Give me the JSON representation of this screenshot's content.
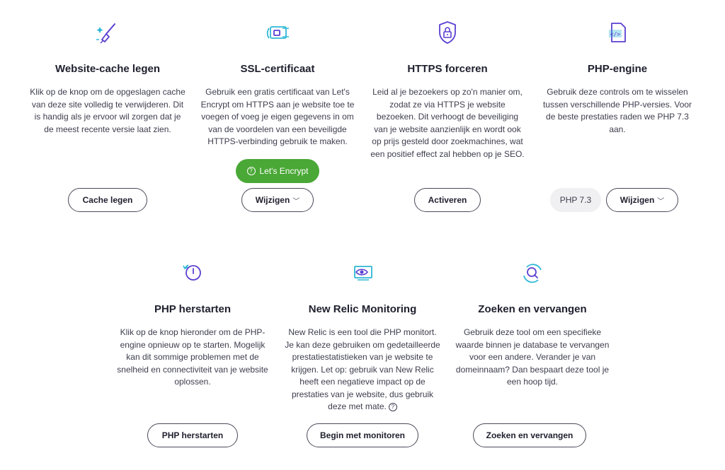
{
  "colors": {
    "accent_purple": "#5b3fd1",
    "accent_cyan": "#2fb8d6",
    "green": "#4aa836"
  },
  "cards": [
    {
      "icon": "broom-icon",
      "title": "Website-cache legen",
      "description": "Klik op de knop om de opgeslagen cache van deze site volledig te verwijderen. Dit is handig als je ervoor wil zorgen dat je de meest recente versie laat zien.",
      "button_label": "Cache legen"
    },
    {
      "icon": "ssl-certificate-icon",
      "title": "SSL-certificaat",
      "description": "Gebruik een gratis certificaat van Let's Encrypt om HTTPS aan je website toe te voegen of voeg je eigen gegevens in om van de voordelen van een beveiligde HTTPS-verbinding gebruik te maken.",
      "badge_label": "Let's Encrypt",
      "button_label": "Wijzigen"
    },
    {
      "icon": "shield-lock-icon",
      "title": "HTTPS forceren",
      "description": "Leid al je bezoekers op zo'n manier om, zodat ze via HTTPS je website bezoeken. Dit verhoogt de beveiliging van je website aanzienlijk en wordt ook op prijs gesteld door zoekmachines, wat een positief effect zal hebben op je SEO.",
      "button_label": "Activeren"
    },
    {
      "icon": "php-file-icon",
      "title": "PHP-engine",
      "description": "Gebruik deze controls om te wisselen tussen verschillende PHP-versies. Voor de beste prestaties raden we PHP 7.3 aan.",
      "version_label": "PHP 7.3",
      "button_label": "Wijzigen"
    },
    {
      "icon": "power-restart-icon",
      "title": "PHP herstarten",
      "description": "Klik op de knop hieronder om de PHP-engine opnieuw op te starten. Mogelijk kan dit sommige problemen met de snelheid en connectiviteit van je website oplossen.",
      "button_label": "PHP herstarten"
    },
    {
      "icon": "monitor-eye-icon",
      "title": "New Relic Monitoring",
      "description": "New Relic is een tool die PHP monitort. Je kan deze gebruiken om gedetailleerde prestatiestatistieken van je website te krijgen. Let op: gebruik van New Relic heeft een negatieve impact op de prestaties van je website, dus gebruik deze met mate.",
      "button_label": "Begin met monitoren"
    },
    {
      "icon": "search-replace-icon",
      "title": "Zoeken en vervangen",
      "description": "Gebruik deze tool om een specifieke waarde binnen je database te vervangen voor een andere. Verander je van domeinnaam? Dan bespaart deze tool je een hoop tijd.",
      "button_label": "Zoeken en vervangen"
    }
  ]
}
